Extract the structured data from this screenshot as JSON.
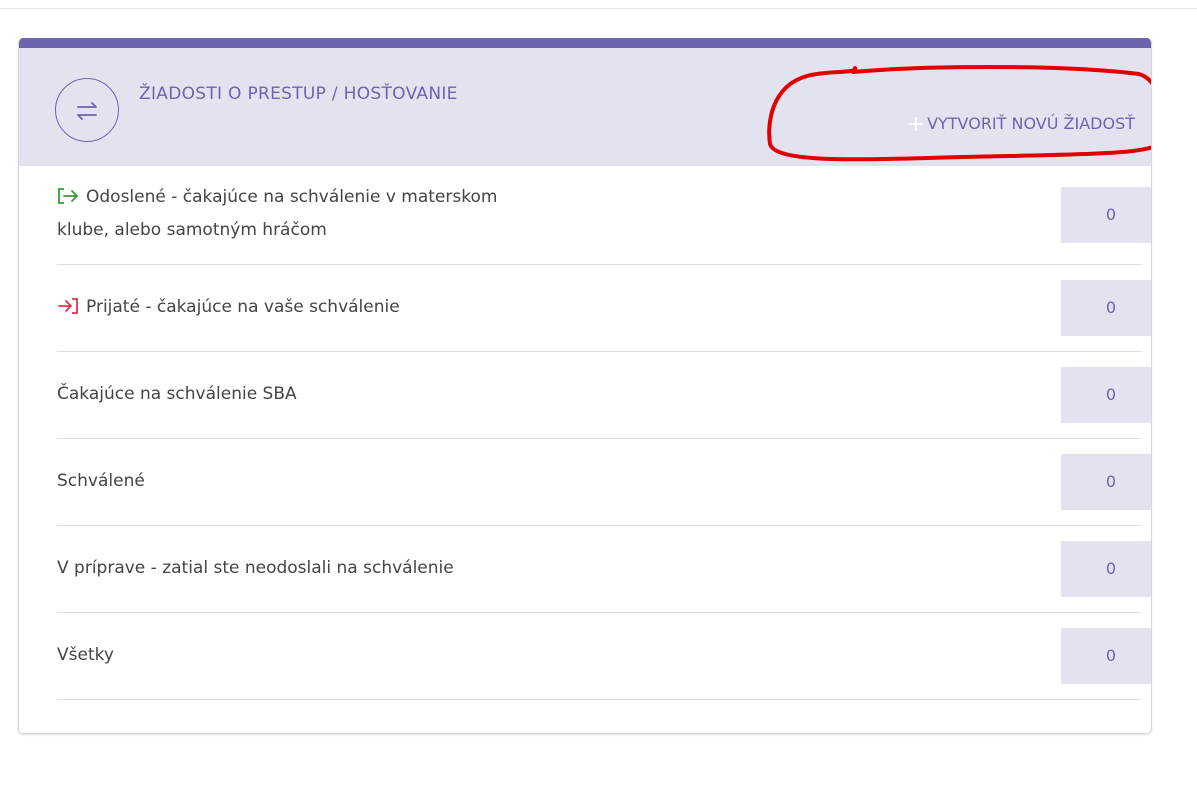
{
  "header": {
    "title": "ŽIADOSTI O PRESTUP / HOSŤOVANIE",
    "create_label": "VYTVORIŤ NOVÚ ŽIADOSŤ",
    "create_plus": "+"
  },
  "rows": [
    {
      "label_line1": "Odoslené - čakajúce na schválenie v materskom",
      "label_line2": "klube, alebo samotným hráčom",
      "count": "0",
      "icon": "outgoing-icon"
    },
    {
      "label": "Prijaté - čakajúce na vaše schválenie",
      "count": "0",
      "icon": "incoming-icon"
    },
    {
      "label": "Čakajúce na schválenie SBA",
      "count": "0"
    },
    {
      "label": "Schválené",
      "count": "0"
    },
    {
      "label": "V príprave - zatial ste neodoslali na schválenie",
      "count": "0"
    },
    {
      "label": "Všetky",
      "count": "0"
    }
  ],
  "colors": {
    "accent": "#6b65b0",
    "header_bg": "#e3e3f0",
    "outgoing": "#3a9a3a",
    "incoming": "#e0344a",
    "annotation": "#e00000"
  }
}
